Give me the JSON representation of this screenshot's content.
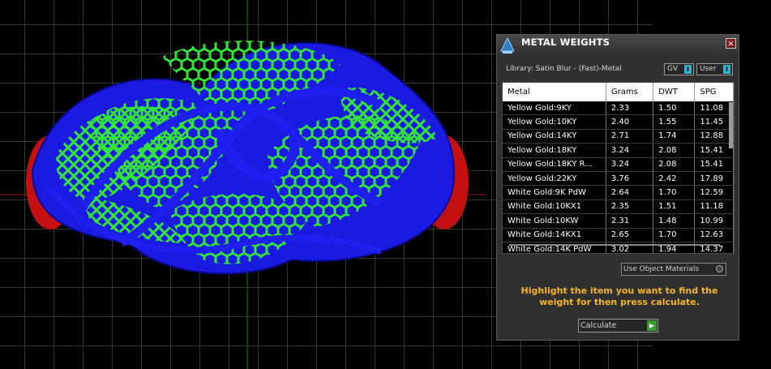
{
  "panel": {
    "title": "METAL WEIGHTS",
    "close_label": "×",
    "library_label": "Library: Satin Blur - (Fast)-Metal",
    "toggles": [
      {
        "label": "GV",
        "state": "I"
      },
      {
        "label": "User",
        "state": "I"
      }
    ],
    "table": {
      "headers": [
        "Metal",
        "Grams",
        "DWT",
        "SPG"
      ],
      "rows": [
        [
          "Yellow Gold:9KY",
          "2.33",
          "1.50",
          "11.08"
        ],
        [
          "Yellow Gold:10KY",
          "2.40",
          "1.55",
          "11.45"
        ],
        [
          "Yellow Gold:14KY",
          "2.71",
          "1.74",
          "12.88"
        ],
        [
          "Yellow Gold:18KY",
          "3.24",
          "2.08",
          "15.41"
        ],
        [
          "Yellow Gold:18KY R...",
          "3.24",
          "2.08",
          "15.41"
        ],
        [
          "Yellow Gold:22KY",
          "3.76",
          "2.42",
          "17.89"
        ],
        [
          "White Gold:9K PdW",
          "2.64",
          "1.70",
          "12.59"
        ],
        [
          "White Gold:10KX1",
          "2.35",
          "1.51",
          "11.18"
        ],
        [
          "White Gold:10KW",
          "2.31",
          "1.48",
          "10.99"
        ],
        [
          "White Gold:14KX1",
          "2.65",
          "1.70",
          "12.63"
        ],
        [
          "White Gold:14K PdW",
          "3.02",
          "1.94",
          "14.37"
        ]
      ]
    },
    "use_object_materials_label": "Use Object Materials",
    "hint": "Highlight the item you want to find the weight for then press calculate.",
    "calculate_label": "Calculate",
    "colors": {
      "hint": "#f5b52c",
      "accent": "#2fb4d8",
      "go": "#3b9c2e"
    }
  },
  "icons": [
    "scale-icon",
    "close-icon",
    "radio-icon",
    "play-arrow-icon"
  ]
}
